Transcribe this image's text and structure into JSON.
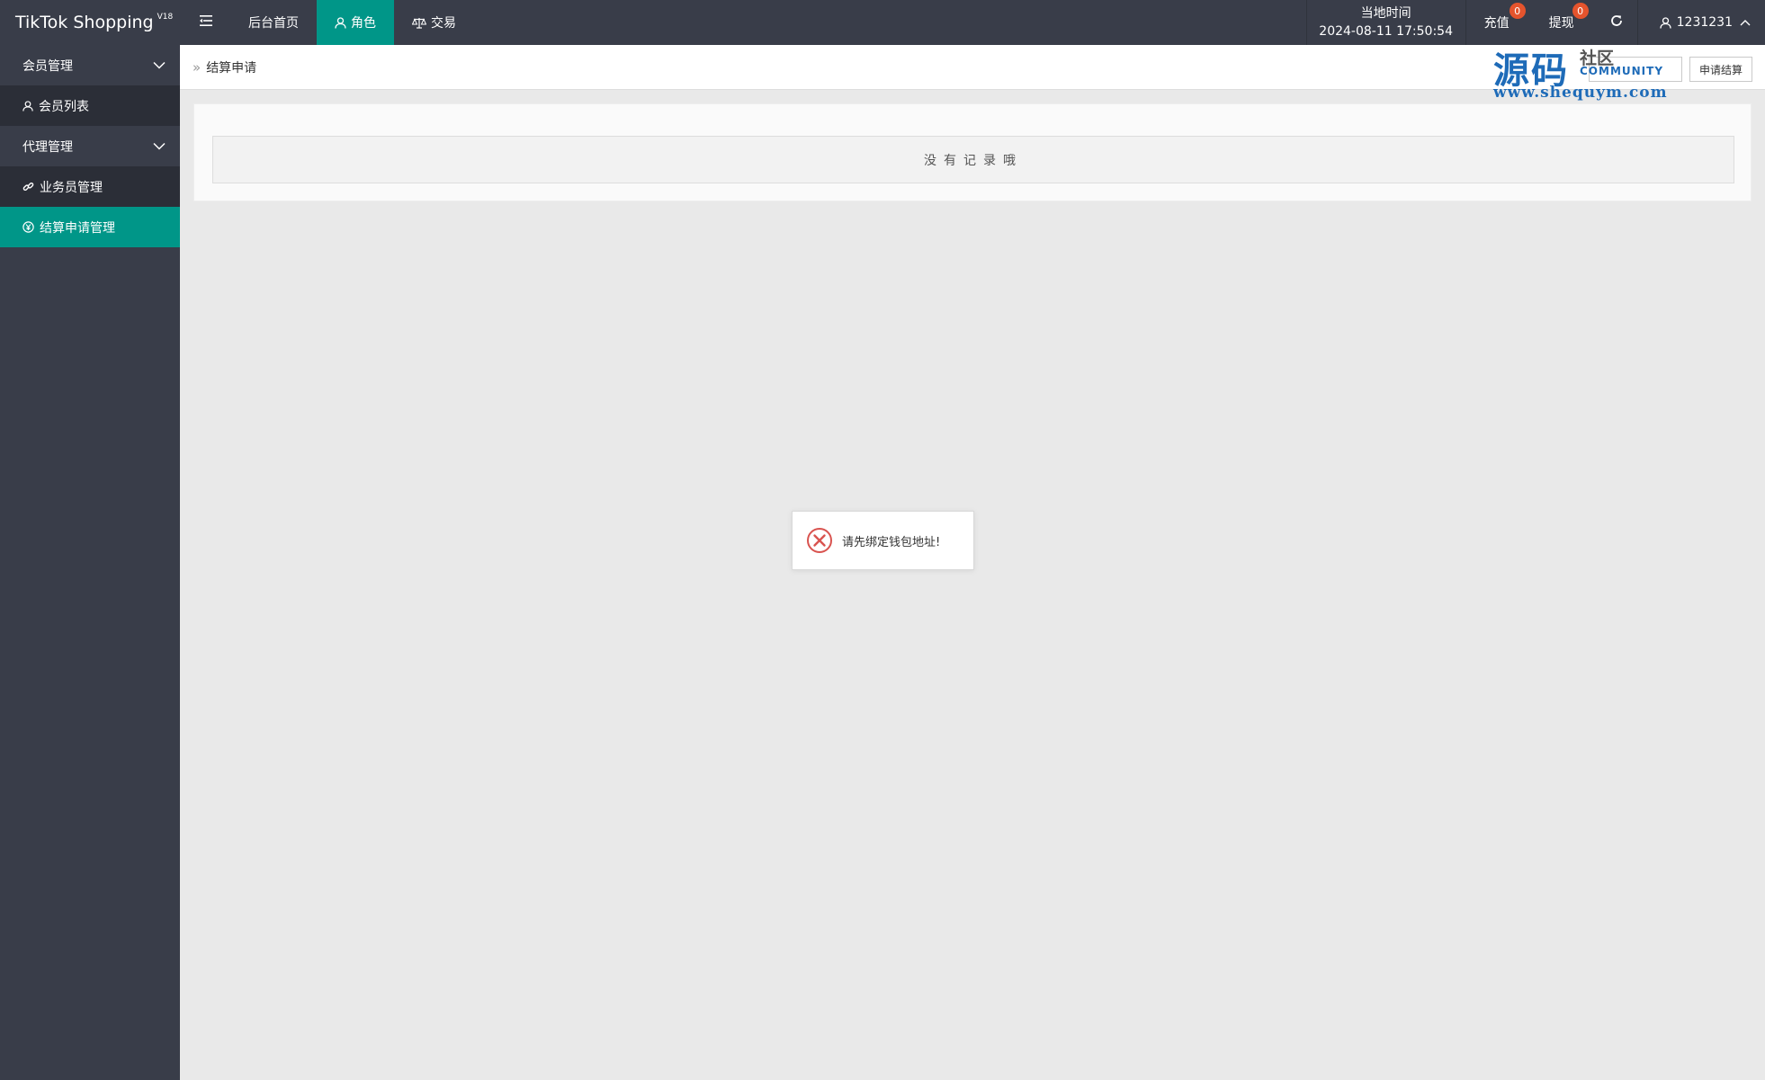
{
  "app": {
    "title": "TikTok Shopping",
    "version": "V18"
  },
  "header": {
    "nav": [
      {
        "label": "后台首页"
      },
      {
        "label": "角色"
      },
      {
        "label": "交易"
      }
    ],
    "clock": {
      "label": "当地时间",
      "value": "2024-08-11 17:50:54"
    },
    "charge": {
      "label": "充值",
      "badge": "0"
    },
    "withdraw": {
      "label": "提现",
      "badge": "0"
    },
    "user": {
      "name": "1231231"
    }
  },
  "sidebar": {
    "groups": [
      {
        "label": "会员管理",
        "items": [
          {
            "label": "会员列表",
            "icon": "user-icon"
          }
        ]
      },
      {
        "label": "代理管理",
        "items": [
          {
            "label": "业务员管理",
            "icon": "link-icon"
          },
          {
            "label": "结算申请管理",
            "icon": "yen-circle-icon"
          }
        ]
      }
    ]
  },
  "breadcrumb": {
    "current": "结算申请"
  },
  "toolbar": {
    "apply_label": "申请结算"
  },
  "watermark": {
    "big": "源码",
    "small": "社区",
    "community": "COMMUNITY",
    "url": "www.shequym.com"
  },
  "content": {
    "empty_text": "没有记录哦"
  },
  "toast": {
    "message": "请先绑定钱包地址!"
  },
  "colors": {
    "header_bg": "#393d49",
    "accent": "#009688",
    "badge": "#e5542d",
    "error": "#d9534f"
  }
}
